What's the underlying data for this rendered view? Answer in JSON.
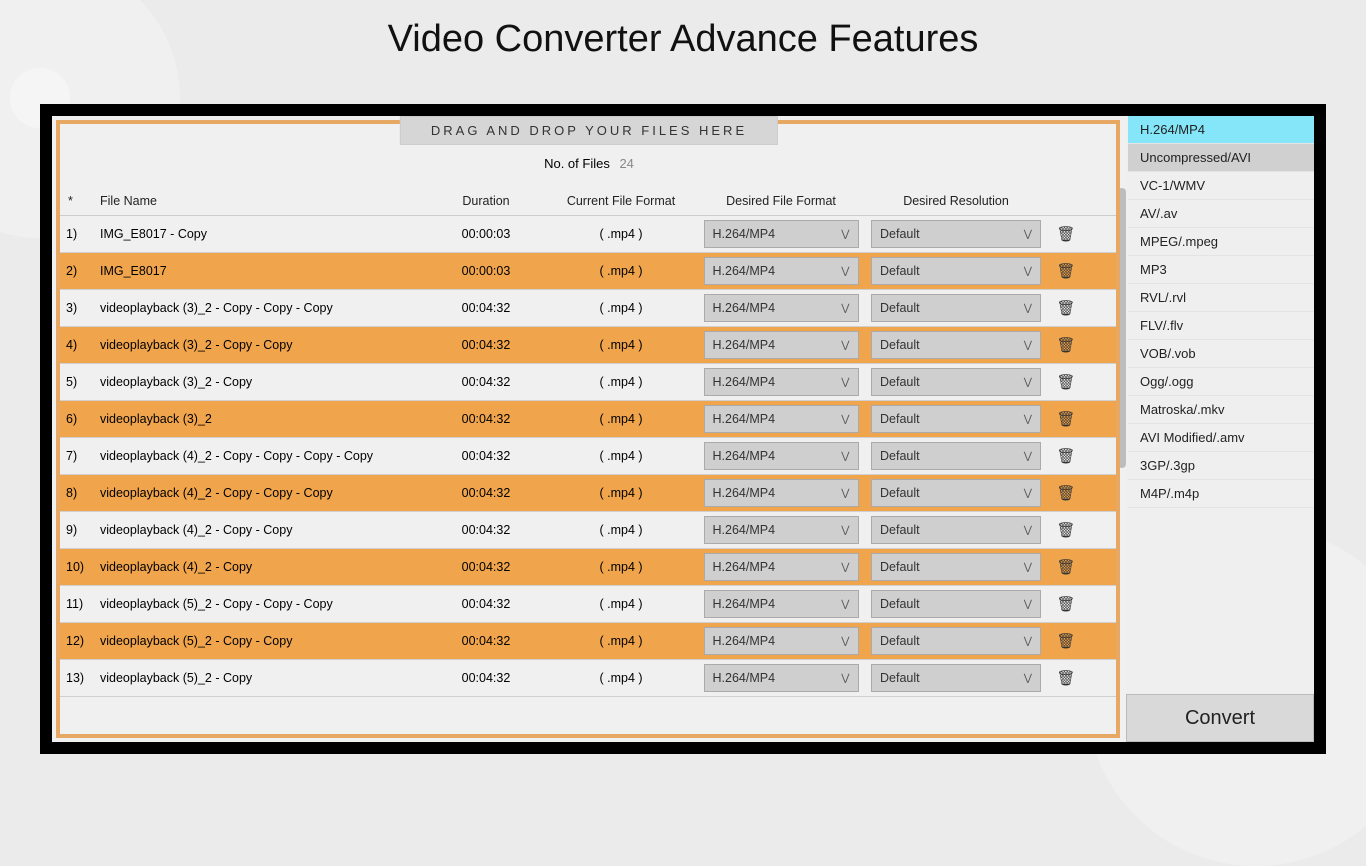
{
  "page_title": "Video Converter Advance Features",
  "drop_banner": "DRAG AND DROP YOUR FILES HERE",
  "file_count_label": "No. of Files",
  "file_count_value": "24",
  "headers": {
    "idx": "*",
    "name": "File Name",
    "duration": "Duration",
    "current_format": "Current File Format",
    "desired_format": "Desired File Format",
    "desired_resolution": "Desired Resolution"
  },
  "default_format": "H.264/MP4",
  "default_resolution": "Default",
  "rows": [
    {
      "idx": "1)",
      "name": "IMG_E8017 - Copy",
      "duration": "00:00:03",
      "fmt": "( .mp4 )",
      "hl": false
    },
    {
      "idx": "2)",
      "name": "IMG_E8017",
      "duration": "00:00:03",
      "fmt": "( .mp4 )",
      "hl": true
    },
    {
      "idx": "3)",
      "name": "videoplayback (3)_2 - Copy - Copy - Copy",
      "duration": "00:04:32",
      "fmt": "( .mp4 )",
      "hl": false
    },
    {
      "idx": "4)",
      "name": "videoplayback (3)_2 - Copy - Copy",
      "duration": "00:04:32",
      "fmt": "( .mp4 )",
      "hl": true
    },
    {
      "idx": "5)",
      "name": "videoplayback (3)_2 - Copy",
      "duration": "00:04:32",
      "fmt": "( .mp4 )",
      "hl": false
    },
    {
      "idx": "6)",
      "name": "videoplayback (3)_2",
      "duration": "00:04:32",
      "fmt": "( .mp4 )",
      "hl": true
    },
    {
      "idx": "7)",
      "name": "videoplayback (4)_2 - Copy - Copy - Copy - Copy",
      "duration": "00:04:32",
      "fmt": "( .mp4 )",
      "hl": false
    },
    {
      "idx": "8)",
      "name": "videoplayback (4)_2 - Copy - Copy - Copy",
      "duration": "00:04:32",
      "fmt": "( .mp4 )",
      "hl": true
    },
    {
      "idx": "9)",
      "name": "videoplayback (4)_2 - Copy - Copy",
      "duration": "00:04:32",
      "fmt": "( .mp4 )",
      "hl": false
    },
    {
      "idx": "10)",
      "name": "videoplayback (4)_2 - Copy",
      "duration": "00:04:32",
      "fmt": "( .mp4 )",
      "hl": true
    },
    {
      "idx": "11)",
      "name": "videoplayback (5)_2 - Copy - Copy - Copy",
      "duration": "00:04:32",
      "fmt": "( .mp4 )",
      "hl": false
    },
    {
      "idx": "12)",
      "name": "videoplayback (5)_2 - Copy - Copy",
      "duration": "00:04:32",
      "fmt": "( .mp4 )",
      "hl": true
    },
    {
      "idx": "13)",
      "name": "videoplayback (5)_2 - Copy",
      "duration": "00:04:32",
      "fmt": "( .mp4 )",
      "hl": false
    }
  ],
  "formats": [
    {
      "label": "H.264/MP4",
      "state": "selected"
    },
    {
      "label": "Uncompressed/AVI",
      "state": "hover"
    },
    {
      "label": "VC-1/WMV",
      "state": ""
    },
    {
      "label": "AV/.av",
      "state": ""
    },
    {
      "label": "MPEG/.mpeg",
      "state": ""
    },
    {
      "label": "MP3",
      "state": ""
    },
    {
      "label": "RVL/.rvl",
      "state": ""
    },
    {
      "label": "FLV/.flv",
      "state": ""
    },
    {
      "label": "VOB/.vob",
      "state": ""
    },
    {
      "label": "Ogg/.ogg",
      "state": ""
    },
    {
      "label": "Matroska/.mkv",
      "state": ""
    },
    {
      "label": "AVI Modified/.amv",
      "state": ""
    },
    {
      "label": "3GP/.3gp",
      "state": ""
    },
    {
      "label": "M4P/.m4p",
      "state": ""
    }
  ],
  "convert_label": "Convert"
}
